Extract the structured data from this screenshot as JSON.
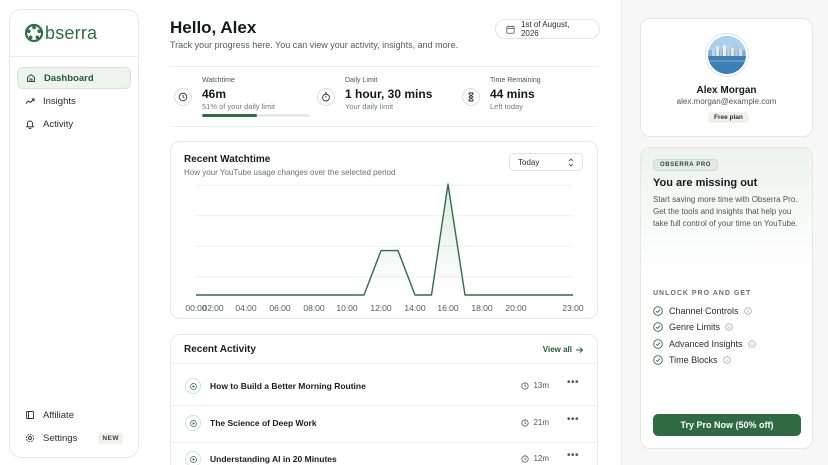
{
  "brand": {
    "name": "bserra",
    "accent": "#2e6e45"
  },
  "sidebar": {
    "items": [
      {
        "label": "Dashboard",
        "icon": "home-icon",
        "active": true
      },
      {
        "label": "Insights",
        "icon": "trend-icon"
      },
      {
        "label": "Activity",
        "icon": "bell-icon"
      }
    ],
    "bottom_items": [
      {
        "label": "Affiliate",
        "icon": "affiliate-icon"
      },
      {
        "label": "Settings",
        "icon": "gear-icon",
        "badge": "NEW"
      }
    ]
  },
  "header": {
    "greeting": "Hello, Alex",
    "subtitle": "Track your progress here. You can view your activity, insights, and more.",
    "date": "1st of August, 2026"
  },
  "stats": [
    {
      "label": "Watchtime",
      "value": "46m",
      "sub": "51% of your daily limit",
      "icon": "clock-icon",
      "progress": 0.51
    },
    {
      "label": "Daily Limit",
      "value": "1 hour, 30 mins",
      "sub": "Your daily limit",
      "icon": "stopwatch-icon"
    },
    {
      "label": "Time Remaining",
      "value": "44 mins",
      "sub": "Left today",
      "icon": "hourglass-icon"
    }
  ],
  "watchtime": {
    "title": "Recent Watchtime",
    "subtitle": "How your YouTube usage changes over the selected period",
    "range": "Today"
  },
  "chart_data": {
    "type": "area",
    "tick_labels": [
      "00:00",
      "02:00",
      "04:00",
      "06:00",
      "08:00",
      "10:00",
      "12:00",
      "14:00",
      "16:00",
      "18:00",
      "20:00",
      "23:00"
    ],
    "x": [
      0,
      11,
      12,
      13,
      14,
      15,
      16,
      17,
      23
    ],
    "values": [
      0,
      0,
      40,
      40,
      0,
      0,
      100,
      0,
      0
    ],
    "ylim": [
      0,
      110
    ],
    "grid": true,
    "line_color": "#2e6e45"
  },
  "activity": {
    "title": "Recent Activity",
    "view_all": "View all",
    "items": [
      {
        "title": "How to Build a Better Morning Routine",
        "duration": "13m"
      },
      {
        "title": "The Science of Deep Work",
        "duration": "21m"
      },
      {
        "title": "Understanding AI in 20 Minutes",
        "duration": "12m"
      }
    ],
    "more": "•••"
  },
  "profile": {
    "name": "Alex Morgan",
    "email": "alex.morgan@example.com",
    "plan": "Free plan"
  },
  "pro": {
    "tag": "OBSERRA PRO",
    "heading": "You are missing out",
    "body": "Start saving more time with Obserra Pro. Get the tools and insights that help you take full control of your time on YouTube.",
    "unlock_label": "UNLOCK PRO AND GET",
    "features": [
      "Channel Controls",
      "Genre Limits",
      "Advanced Insights",
      "Time Blocks"
    ],
    "cta": "Try Pro Now (50% off)"
  }
}
